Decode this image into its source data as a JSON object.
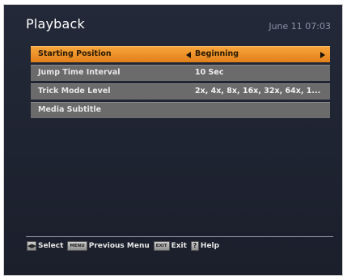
{
  "header": {
    "title": "Playback",
    "datetime": "June 11 07:03"
  },
  "menu": {
    "items": [
      {
        "label": "Starting Position",
        "value": "Beginning",
        "selected": true
      },
      {
        "label": "Jump Time Interval",
        "value": "10 Sec",
        "selected": false
      },
      {
        "label": "Trick Mode Level",
        "value": "2x, 4x, 8x, 16x, 32x, 64x, 1...",
        "selected": false
      },
      {
        "label": "Media Subtitle",
        "value": "",
        "selected": false
      }
    ]
  },
  "footer": {
    "select_key": "◀▶",
    "select_label": "Select",
    "menu_key": "MENU",
    "menu_label": "Previous Menu",
    "exit_key": "EXIT",
    "exit_label": "Exit",
    "help_key": "?",
    "help_label": "Help"
  },
  "colors": {
    "background": "#1f2432",
    "selected_row": "#f29433",
    "row": "#6b6b6b"
  }
}
